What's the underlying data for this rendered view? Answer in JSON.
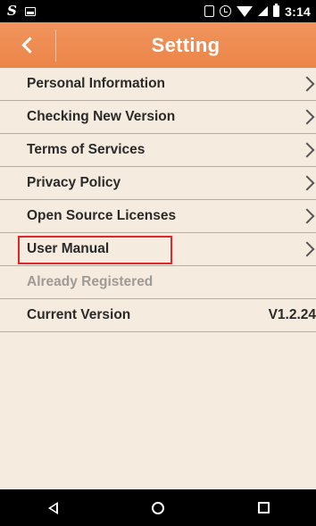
{
  "status_bar": {
    "left_icons": [
      "s-app-icon",
      "image-icon"
    ],
    "right_icons": [
      "vibrate-icon",
      "alarm-icon",
      "wifi-icon",
      "signal-icon",
      "battery-icon"
    ],
    "time": "3:14"
  },
  "header": {
    "title": "Setting",
    "background_color": "#ec8548"
  },
  "menu": {
    "items": [
      {
        "label": "Personal Information",
        "has_chevron": true
      },
      {
        "label": "Checking New Version",
        "has_chevron": true
      },
      {
        "label": "Terms of Services",
        "has_chevron": true
      },
      {
        "label": "Privacy Policy",
        "has_chevron": true
      },
      {
        "label": "Open Source Licenses",
        "has_chevron": true
      },
      {
        "label": "User Manual",
        "has_chevron": true,
        "highlighted": true
      },
      {
        "label": "Already Registered",
        "disabled": true
      },
      {
        "label": "Current Version",
        "value": "V1.2.24"
      }
    ]
  },
  "colors": {
    "background": "#f5ebde",
    "highlight_border": "#e0262a",
    "disabled_text": "#9e9a95"
  },
  "nav_bar": {
    "buttons": [
      "back-icon",
      "home-icon",
      "recent-apps-icon"
    ]
  }
}
